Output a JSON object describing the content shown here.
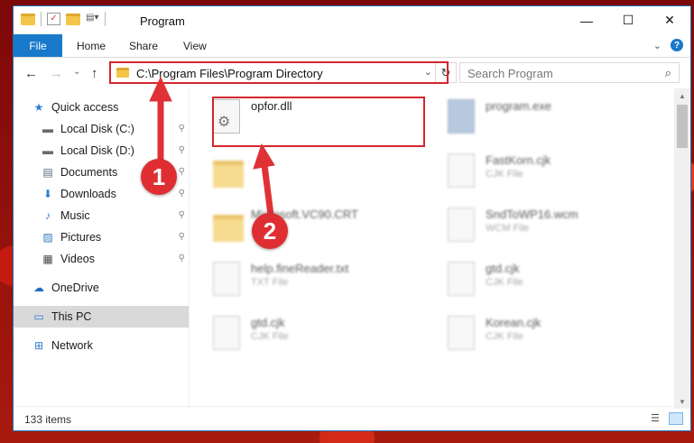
{
  "window": {
    "title": "Program",
    "minimize_icon": "minimize-icon",
    "maximize_icon": "maximize-icon",
    "close_icon": "close-icon",
    "min_glyph": "—",
    "max_glyph": "☐",
    "close_glyph": "✕"
  },
  "ribbon": {
    "tabs": [
      "File",
      "Home",
      "Share",
      "View"
    ],
    "help_glyph": "?"
  },
  "nav": {
    "back_glyph": "←",
    "forward_glyph": "→",
    "recent_glyph": "⌄",
    "up_glyph": "↑"
  },
  "address": {
    "path": "C:\\Program Files\\Program Directory",
    "dropdown_glyph": "⌄",
    "refresh_glyph": "↻"
  },
  "search": {
    "placeholder": "Search Program",
    "icon_glyph": "⌕"
  },
  "sidebar": {
    "items": [
      {
        "label": "Quick access",
        "icon": "star-icon",
        "glyph": "★",
        "color": "#2b7cd3",
        "pinned": false
      },
      {
        "label": "Local Disk (C:)",
        "icon": "drive-icon",
        "glyph": "▬",
        "color": "#6b6b6b",
        "pinned": true
      },
      {
        "label": "Local Disk (D:)",
        "icon": "drive-icon",
        "glyph": "▬",
        "color": "#6b6b6b",
        "pinned": true
      },
      {
        "label": "Documents",
        "icon": "documents-icon",
        "glyph": "▤",
        "color": "#5a6c82",
        "pinned": true
      },
      {
        "label": "Downloads",
        "icon": "download-icon",
        "glyph": "⬇",
        "color": "#2b7cd3",
        "pinned": true
      },
      {
        "label": "Music",
        "icon": "music-icon",
        "glyph": "♪",
        "color": "#2b7cd3",
        "pinned": true
      },
      {
        "label": "Pictures",
        "icon": "pictures-icon",
        "glyph": "▨",
        "color": "#3b7fc4",
        "pinned": true
      },
      {
        "label": "Videos",
        "icon": "videos-icon",
        "glyph": "▦",
        "color": "#444",
        "pinned": true
      },
      {
        "label": "OneDrive",
        "icon": "cloud-icon",
        "glyph": "☁",
        "color": "#1e6fc4",
        "pinned": false
      },
      {
        "label": "This PC",
        "icon": "computer-icon",
        "glyph": "▭",
        "color": "#2b7cd3",
        "pinned": false
      },
      {
        "label": "Network",
        "icon": "network-icon",
        "glyph": "⊞",
        "color": "#2b7cd3",
        "pinned": false
      }
    ],
    "pin_glyph": "📌"
  },
  "files": [
    {
      "name": "opfor.dll",
      "type": "",
      "icon": "dll-file-icon"
    },
    {
      "name": "program.exe",
      "type": "",
      "icon": "exe-file-icon"
    },
    {
      "name": "",
      "type": "",
      "icon": "folder-icon"
    },
    {
      "name": "FastKorn.cjk",
      "type": "CJK File",
      "icon": "file-icon"
    },
    {
      "name": "Microsoft.VC90.CRT",
      "type": "",
      "icon": "folder-icon"
    },
    {
      "name": "SndToWP16.wcm",
      "type": "WCM File",
      "icon": "file-icon"
    },
    {
      "name": "help.fineReader.txt",
      "type": "TXT File",
      "icon": "file-icon"
    },
    {
      "name": "gtd.cjk",
      "type": "CJK File",
      "icon": "file-icon"
    },
    {
      "name": "gtd.cjk",
      "type": "CJK File",
      "icon": "file-icon"
    },
    {
      "name": "Korean.cjk",
      "type": "CJK File",
      "icon": "file-icon"
    }
  ],
  "status": {
    "item_count": "133 items"
  },
  "annotations": {
    "badge_1": "1",
    "badge_2": "2",
    "highlight_color": "#d4262e"
  }
}
